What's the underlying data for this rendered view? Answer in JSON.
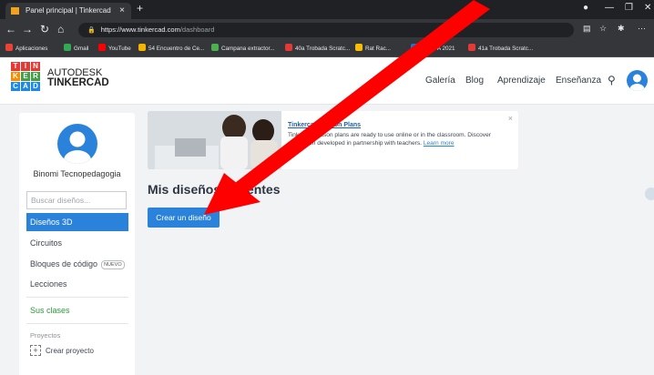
{
  "browser": {
    "tab_title": "Panel principal | Tinkercad",
    "tab_close": "×",
    "new_tab": "+",
    "url_host": "https://www.tinkercad.com",
    "url_path": "/dashboard",
    "bookmarks": [
      {
        "label": "Aplicaciones",
        "color": "#ea4335"
      },
      {
        "label": "Gmail",
        "color": "#34a853"
      },
      {
        "label": "YouTube",
        "color": "#ff0000"
      },
      {
        "label": "54 Encuentro de Ce...",
        "color": "#f4b400"
      },
      {
        "label": "Campana extractor...",
        "color": "#4caf50"
      },
      {
        "label": "40a Trobada Scratc...",
        "color": "#e53935"
      },
      {
        "label": "Rat Rac...",
        "color": "#fbbc05"
      },
      {
        "label": "RENDA 2021",
        "color": "#1976d2"
      },
      {
        "label": "41a Trobada Scratc...",
        "color": "#e53935"
      }
    ]
  },
  "header": {
    "brand_top": "AUTODESK",
    "brand_bottom": "TINKERCAD",
    "logo_letters": [
      "T",
      "I",
      "N",
      "K",
      "E",
      "R",
      "C",
      "A",
      "D"
    ],
    "nav": [
      "Galería",
      "Blog",
      "Aprendizaje",
      "Enseñanza"
    ]
  },
  "sidebar": {
    "username": "Binomi Tecnopedagogia",
    "search_placeholder": "Buscar diseños...",
    "items": [
      "Diseños 3D",
      "Circuitos",
      "Bloques de código",
      "Lecciones"
    ],
    "badge": "NUEVO",
    "classes": "Sus clases",
    "projects_label": "Proyectos",
    "new_project": "Crear proyecto",
    "plus": "+"
  },
  "banner": {
    "title": "Tinkercad Lesson Plans",
    "text": "Tinkercad lesson plans are ready to use online or in the classroom. Discover curriculum developed in partnership with teachers.",
    "link": "Learn more",
    "close": "×"
  },
  "main": {
    "title": "Mis diseños recientes",
    "create_button": "Crear un diseño"
  },
  "colors": {
    "accent": "#2a82da",
    "annotation_arrow": "#ff0000"
  }
}
